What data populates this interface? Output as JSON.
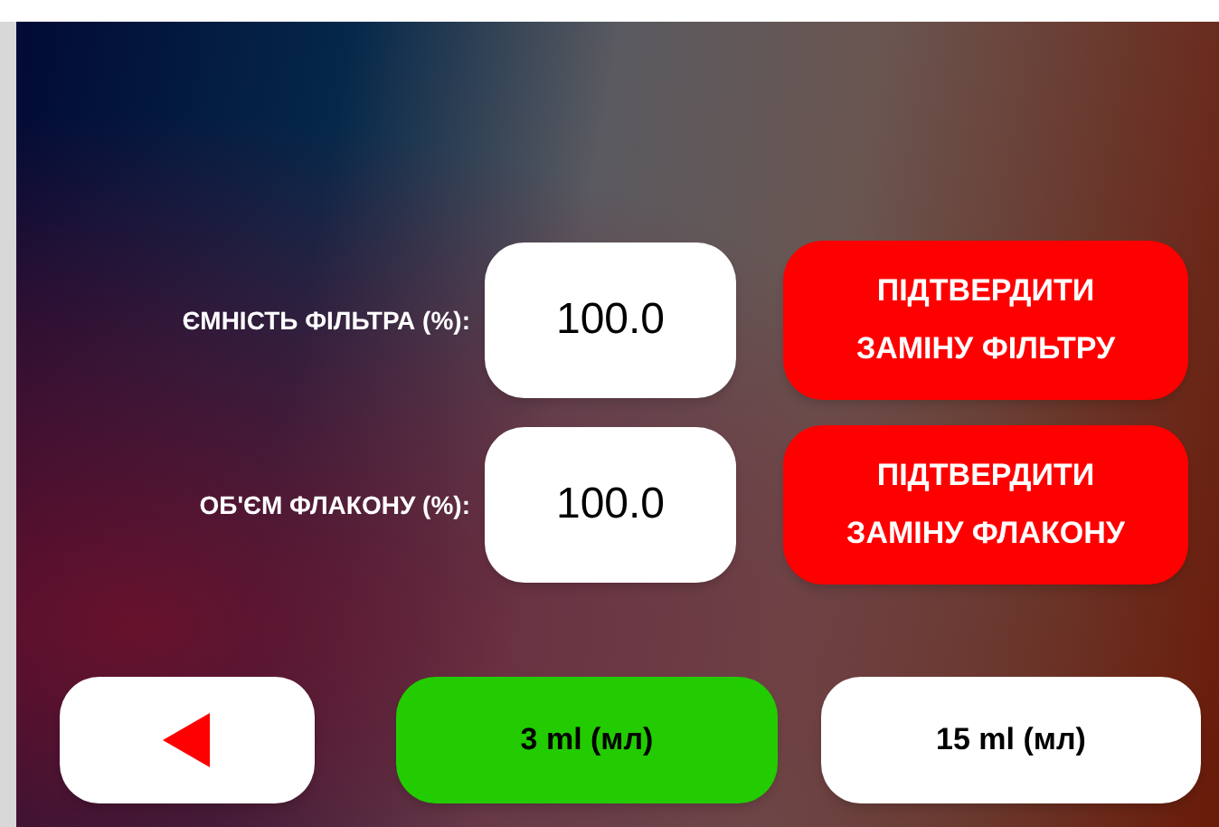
{
  "fields": [
    {
      "label": "ЄМНІСТЬ ФІЛЬТРА (%):",
      "value": "100.0",
      "button": "ПІДТВЕРДИТИ\nЗАМІНУ ФІЛЬТРУ"
    },
    {
      "label": "ОБ'ЄМ ФЛАКОНУ (%):",
      "value": "100.0",
      "button": "ПІДТВЕРДИТИ\nЗАМІНУ ФЛАКОНУ"
    }
  ],
  "volumes": [
    {
      "label": "3 ml (мл)",
      "selected": true
    },
    {
      "label": "15 ml (мл)",
      "selected": false
    }
  ]
}
